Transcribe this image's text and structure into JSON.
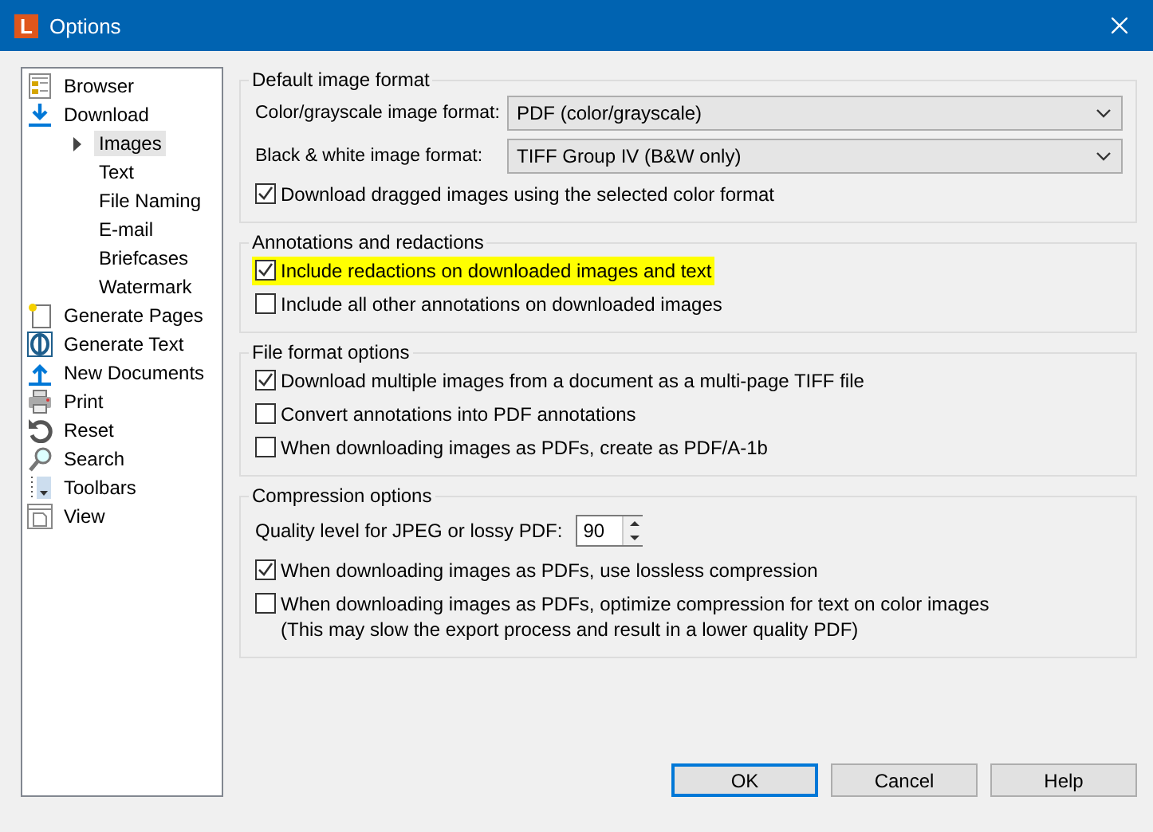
{
  "window": {
    "title": "Options",
    "logo": "L"
  },
  "sidebar": {
    "items": [
      {
        "label": "Browser",
        "selected": false
      },
      {
        "label": "Download",
        "selected": false,
        "children": [
          {
            "label": "Images",
            "selected": true
          },
          {
            "label": "Text",
            "selected": false
          },
          {
            "label": "File Naming",
            "selected": false
          },
          {
            "label": "E-mail",
            "selected": false
          },
          {
            "label": "Briefcases",
            "selected": false
          },
          {
            "label": "Watermark",
            "selected": false
          }
        ]
      },
      {
        "label": "Generate Pages",
        "selected": false
      },
      {
        "label": "Generate Text",
        "selected": false
      },
      {
        "label": "New Documents",
        "selected": false
      },
      {
        "label": "Print",
        "selected": false
      },
      {
        "label": "Reset",
        "selected": false
      },
      {
        "label": "Search",
        "selected": false
      },
      {
        "label": "Toolbars",
        "selected": false
      },
      {
        "label": "View",
        "selected": false
      }
    ]
  },
  "groups": [
    {
      "title": "Default image format",
      "rows": [
        {
          "kind": "dropdown",
          "label": "Color/grayscale image format:",
          "value": "PDF (color/grayscale)"
        },
        {
          "kind": "dropdown",
          "label": "Black & white image format:",
          "value": "TIFF Group IV (B&W only)"
        },
        {
          "kind": "checkbox",
          "label": "Download dragged images using the selected color format",
          "checked": true,
          "highlighted": false
        }
      ]
    },
    {
      "title": "Annotations and redactions",
      "rows": [
        {
          "kind": "checkbox",
          "label": "Include redactions on downloaded images and text",
          "checked": true,
          "highlighted": true
        },
        {
          "kind": "checkbox",
          "label": "Include all other annotations on downloaded images",
          "checked": false,
          "highlighted": false
        }
      ]
    },
    {
      "title": "File format options",
      "rows": [
        {
          "kind": "checkbox",
          "label": "Download multiple images from a document as a multi-page TIFF file",
          "checked": true,
          "highlighted": false
        },
        {
          "kind": "checkbox",
          "label": "Convert annotations into PDF annotations",
          "checked": false,
          "highlighted": false
        },
        {
          "kind": "checkbox",
          "label": "When downloading images as PDFs, create as PDF/A-1b",
          "checked": false,
          "highlighted": false
        }
      ]
    },
    {
      "title": "Compression options",
      "rows": [
        {
          "kind": "spinner",
          "label": "Quality level for JPEG or lossy PDF:",
          "value": "90"
        },
        {
          "kind": "checkbox",
          "label": "When downloading images as PDFs, use lossless compression",
          "checked": true,
          "highlighted": false
        },
        {
          "kind": "checkbox",
          "label": "When downloading images as PDFs, optimize compression for text on color images",
          "note": "(This may slow the export process and result in a lower quality PDF)",
          "checked": false,
          "highlighted": false
        }
      ]
    }
  ],
  "buttons": [
    {
      "label": "OK",
      "default": true
    },
    {
      "label": "Cancel",
      "default": false
    },
    {
      "label": "Help",
      "default": false
    }
  ]
}
